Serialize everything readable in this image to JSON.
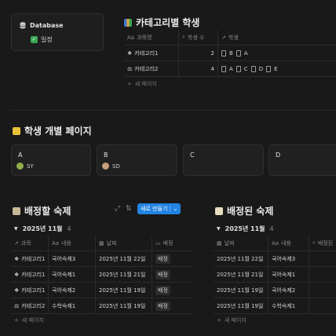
{
  "database_card": {
    "title": "Database",
    "item": "일정"
  },
  "category_table": {
    "title": "카테고리별 학생",
    "headers": {
      "subject": "과목명",
      "count": "학생 수",
      "students": "학생"
    },
    "rows": [
      {
        "subject": "카테고리1",
        "count": "2",
        "students": [
          "B",
          "A"
        ]
      },
      {
        "subject": "카테고리2",
        "count": "4",
        "students": [
          "A",
          "C",
          "D",
          "E"
        ]
      }
    ],
    "new_page": "새 페이지"
  },
  "gallery": {
    "title": "학생 개별 페이지",
    "cards": [
      {
        "name": "A",
        "person": "SY"
      },
      {
        "name": "B",
        "person": "SD"
      },
      {
        "name": "C",
        "person": ""
      },
      {
        "name": "D",
        "person": ""
      }
    ]
  },
  "assign_table": {
    "title": "배정할 숙제",
    "new_button": "새로 만들기",
    "group": {
      "label": "2025년 11월",
      "count": "4"
    },
    "headers": {
      "subject": "과목",
      "content": "내용",
      "date": "날짜",
      "assign": "배정"
    },
    "rows": [
      {
        "subject": "카테고리1",
        "content": "국어숙제3",
        "date": "2025년 11월 22일",
        "assign": "배정"
      },
      {
        "subject": "카테고리1",
        "content": "국어숙제1",
        "date": "2025년 11월 21일",
        "assign": "배정"
      },
      {
        "subject": "카테고리1",
        "content": "국어숙제2",
        "date": "2025년 11월 19일",
        "assign": "배정"
      },
      {
        "subject": "카테고리2",
        "content": "수학숙제1",
        "date": "2025년 11월 19일",
        "assign": "배정"
      }
    ],
    "new_page": "새 페이지"
  },
  "assigned_table": {
    "title": "배정된 숙제",
    "group": {
      "label": "2025년 11월",
      "count": "4"
    },
    "headers": {
      "date": "날짜",
      "content": "내용",
      "assign": "배정된"
    },
    "rows": [
      {
        "date": "2025년 11월 22일",
        "content": "국어숙제3"
      },
      {
        "date": "2025년 11월 21일",
        "content": "국어숙제1"
      },
      {
        "date": "2025년 11월 19일",
        "content": "국어숙제2"
      },
      {
        "date": "2025년 11월 19일",
        "content": "수학숙제1"
      }
    ],
    "new_page": "새 페이지"
  },
  "colors": {
    "accent": "#2383e2",
    "check": "#3aa655"
  }
}
